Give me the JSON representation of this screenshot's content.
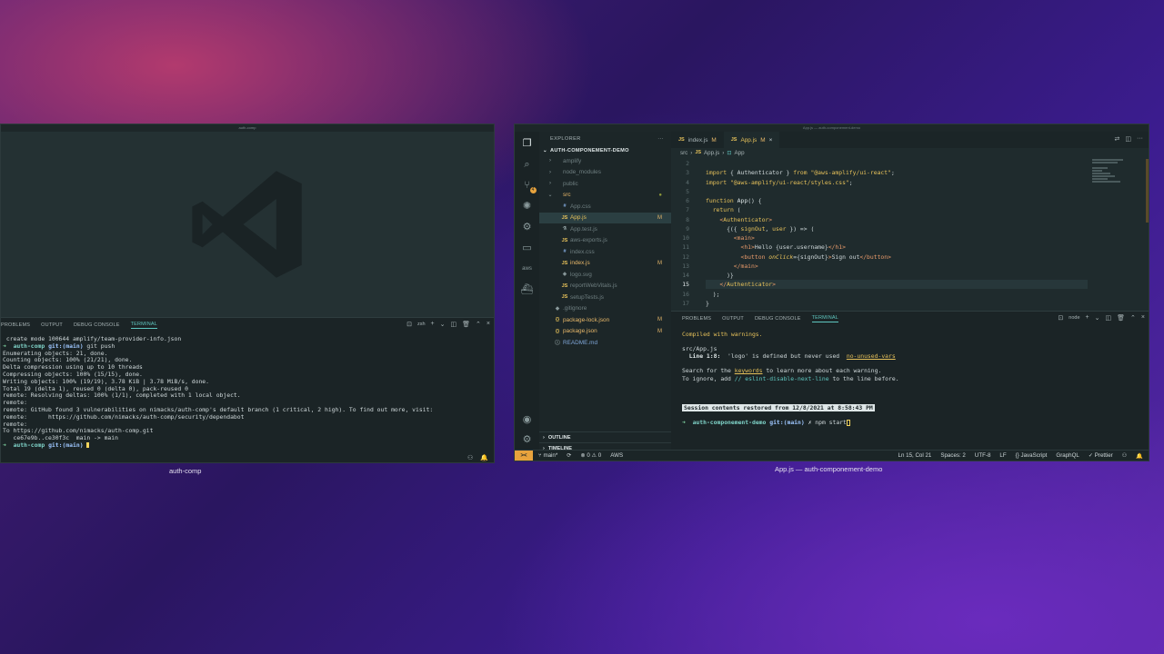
{
  "left_window": {
    "title": "auth-comp",
    "label": "auth-comp",
    "panel_tabs": [
      "PROBLEMS",
      "OUTPUT",
      "DEBUG CONSOLE",
      "TERMINAL"
    ],
    "terminal_shell": "zsh",
    "terminal_lines": [
      " create mode 100644 amplify/team-provider-info.json",
      "Enumerating objects: 21, done.",
      "Counting objects: 100% (21/21), done.",
      "Delta compression using up to 10 threads",
      "Compressing objects: 100% (15/15), done.",
      "Writing objects: 100% (19/19), 3.78 KiB | 3.78 MiB/s, done.",
      "Total 19 (delta 1), reused 0 (delta 0), pack-reused 0",
      "remote: Resolving deltas: 100% (1/1), completed with 1 local object.",
      "remote:",
      "remote: GitHub found 3 vulnerabilities on nimacks/auth-comp's default branch (1 critical, 2 high). To find out more, visit:",
      "remote:      https://github.com/nimacks/auth-comp/security/dependabot",
      "remote:",
      "To https://github.com/nimacks/auth-comp.git",
      "   ce67e9b..ce30f3c  main -> main"
    ],
    "prompt1": {
      "arrow": "➜",
      "dir": "auth-comp",
      "git": "git:(main)",
      "cmd": " git push"
    },
    "prompt2": {
      "arrow": "➜",
      "dir": "auth-comp",
      "git": "git:(main)"
    }
  },
  "right_window": {
    "title": "App.js — auth-componement-demo",
    "label": "App.js — auth-componement-demo",
    "explorer": {
      "header": "EXPLORER",
      "project": "AUTH-COMPONEMENT-DEMO",
      "items": [
        {
          "indent": 1,
          "chev": "›",
          "name": "amplify",
          "cls": "c-dim",
          "icon": ""
        },
        {
          "indent": 1,
          "chev": "›",
          "name": "node_modules",
          "cls": "c-dim",
          "icon": ""
        },
        {
          "indent": 1,
          "chev": "›",
          "name": "public",
          "cls": "c-dim",
          "icon": ""
        },
        {
          "indent": 1,
          "chev": "⌄",
          "name": "src",
          "cls": "c-mod",
          "icon": "",
          "mark": "●"
        },
        {
          "indent": 2,
          "chev": "",
          "name": "App.css",
          "cls": "c-dim",
          "icon": "#"
        },
        {
          "indent": 2,
          "chev": "",
          "name": "App.js",
          "cls": "c-mod",
          "icon": "JS",
          "mark": "M",
          "selected": true
        },
        {
          "indent": 2,
          "chev": "",
          "name": "App.test.js",
          "cls": "c-dim",
          "icon": "⚗"
        },
        {
          "indent": 2,
          "chev": "",
          "name": "aws-exports.js",
          "cls": "c-dim",
          "icon": "JS"
        },
        {
          "indent": 2,
          "chev": "",
          "name": "index.css",
          "cls": "c-dim",
          "icon": "#"
        },
        {
          "indent": 2,
          "chev": "",
          "name": "index.js",
          "cls": "c-mod",
          "icon": "JS",
          "mark": "M"
        },
        {
          "indent": 2,
          "chev": "",
          "name": "logo.svg",
          "cls": "c-dim",
          "icon": "◈"
        },
        {
          "indent": 2,
          "chev": "",
          "name": "reportWebVitals.js",
          "cls": "c-dim",
          "icon": "JS"
        },
        {
          "indent": 2,
          "chev": "",
          "name": "setupTests.js",
          "cls": "c-dim",
          "icon": "JS"
        },
        {
          "indent": 1,
          "chev": "",
          "name": ".gitignore",
          "cls": "c-dim",
          "icon": "◆"
        },
        {
          "indent": 1,
          "chev": "",
          "name": "package-lock.json",
          "cls": "c-mod",
          "icon": "{}",
          "mark": "M"
        },
        {
          "indent": 1,
          "chev": "",
          "name": "package.json",
          "cls": "c-mod",
          "icon": "{}",
          "mark": "M"
        },
        {
          "indent": 1,
          "chev": "",
          "name": "README.md",
          "cls": "c-blue",
          "icon": "ⓘ"
        }
      ],
      "outline": "OUTLINE",
      "timeline": "TIMELINE"
    },
    "tabs": [
      {
        "icon": "JS",
        "name": "index.js",
        "mark": "M",
        "active": false
      },
      {
        "icon": "JS",
        "name": "App.js",
        "mark": "M",
        "active": true,
        "close": "×"
      }
    ],
    "breadcrumbs": [
      "src",
      "›",
      "JS",
      "App.js",
      "›",
      "⊡",
      "App"
    ],
    "code_lines": [
      {
        "n": "2",
        "html": ""
      },
      {
        "n": "3",
        "html": "<span class='k'>import</span> <span class='pl'>{ Authenticator } </span><span class='k'>from</span> <span class='s'>\"@aws-amplify/ui-react\"</span><span class='pl'>;</span>"
      },
      {
        "n": "4",
        "html": "<span class='k'>import</span> <span class='s'>\"@aws-amplify/ui-react/styles.css\"</span><span class='pl'>;</span>"
      },
      {
        "n": "5",
        "html": ""
      },
      {
        "n": "6",
        "html": "<span class='k'>function</span> <span class='vr'>App</span><span class='pl'>() {</span>"
      },
      {
        "n": "7",
        "html": "<span class='pl'>  </span><span class='k'>return</span><span class='pl'> (</span>"
      },
      {
        "n": "8",
        "html": "<span class='pl'>    </span><span class='tg'>&lt;</span><span class='k'>Authenticator</span><span class='tg'>&gt;</span>"
      },
      {
        "n": "9",
        "html": "<span class='pl'>      {({ </span><span class='s'>signOut</span><span class='pl'>, </span><span class='s'>user</span><span class='pl'> }) =&gt; (</span>"
      },
      {
        "n": "10",
        "html": "<span class='pl'>        </span><span class='tg'>&lt;main&gt;</span>"
      },
      {
        "n": "11",
        "html": "<span class='pl'>          </span><span class='tg'>&lt;h1&gt;</span><span class='pl'>Hello {user.username}</span><span class='tg'>&lt;/h1&gt;</span>"
      },
      {
        "n": "12",
        "html": "<span class='pl'>          </span><span class='tg'>&lt;button</span> <span class='at'>onClick</span><span class='pl'>={signOut}</span><span class='tg'>&gt;</span><span class='pl'>Sign out</span><span class='tg'>&lt;/button&gt;</span>"
      },
      {
        "n": "13",
        "html": "<span class='pl'>        </span><span class='tg'>&lt;/main&gt;</span>"
      },
      {
        "n": "14",
        "html": "<span class='pl'>      )}</span>"
      },
      {
        "n": "15",
        "html": "<span class='pl'>    </span><span class='tg'>&lt;/</span><span class='k'>Authenticator</span><span class='tg'>&gt;</span>",
        "current": true
      },
      {
        "n": "16",
        "html": "<span class='pl'>  );</span>"
      },
      {
        "n": "17",
        "html": "<span class='pl'>}</span>"
      }
    ],
    "panel_tabs": [
      "PROBLEMS",
      "OUTPUT",
      "DEBUG CONSOLE",
      "TERMINAL"
    ],
    "terminal_shell": "node",
    "terminal": {
      "compiled": "Compiled with warnings.",
      "file": "src/App.js",
      "line_label": "  Line 1:8:",
      "line_msg": "  'logo' is defined but never used  ",
      "rule": "no-unused-vars",
      "search_a": "Search for the ",
      "keywords": "keywords",
      "search_b": " to learn more about each warning.",
      "ignore_a": "To ignore, add ",
      "ignore_code": "// eslint-disable-next-line",
      "ignore_b": " to the line before.",
      "session": "Session contents restored from 12/8/2021 at 8:58:43 PM",
      "prompt_arrow": "➜",
      "prompt_dir": "auth-componement-demo",
      "prompt_git": "git:(main)",
      "prompt_cmd": " ✗ npm start"
    },
    "status_left": [
      "main*",
      "⟳",
      "⊗ 0 ⚠ 0",
      "AWS"
    ],
    "status_right": [
      "Ln 15, Col 21",
      "Spaces: 2",
      "UTF-8",
      "LF",
      "{} JavaScript",
      "GraphQL",
      "✓ Prettier",
      "⚇",
      "🔔"
    ]
  }
}
